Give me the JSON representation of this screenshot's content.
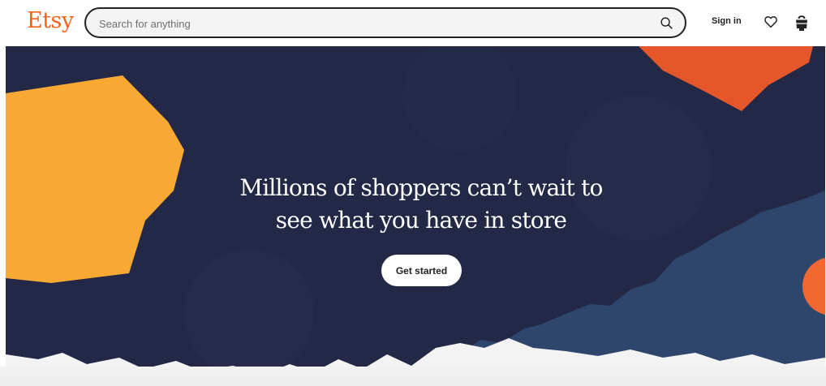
{
  "header": {
    "logo": "Etsy",
    "search": {
      "placeholder": "Search for anything",
      "value": ""
    },
    "signin_label": "Sign in",
    "icons": {
      "search": "search-icon",
      "favorites": "heart-icon",
      "cart": "shopping-bag-icon"
    }
  },
  "hero": {
    "headline_line1": "Millions of shoppers can’t wait to",
    "headline_line2": "see what you have in store",
    "cta_label": "Get started"
  },
  "colors": {
    "brand": "#f1641e",
    "hero_background": "#222845",
    "accent_yellow": "#f7a934",
    "accent_orange": "#e5572b",
    "accent_blue": "#2f466c"
  }
}
